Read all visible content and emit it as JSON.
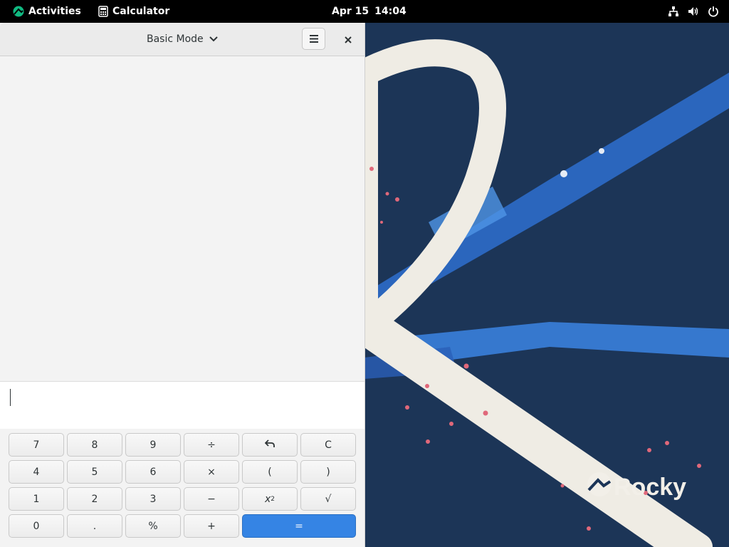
{
  "topbar": {
    "activities": "Activities",
    "app_name": "Calculator",
    "date": "Apr 15",
    "time": "14:04"
  },
  "window": {
    "mode_label": "Basic Mode",
    "display_expression": ""
  },
  "keypad": {
    "row1": [
      "7",
      "8",
      "9",
      "÷",
      "⟲",
      "C"
    ],
    "row2": [
      "4",
      "5",
      "6",
      "×",
      "(",
      ")"
    ],
    "row3": [
      "1",
      "2",
      "3",
      "−",
      "x",
      "√"
    ],
    "row3_superscript": "2",
    "row4": [
      "0",
      ".",
      "%",
      "+",
      "="
    ]
  },
  "wallpaper": {
    "brand": "Rocky"
  },
  "colors": {
    "equals_button": "#3584e4",
    "wallpaper_bg": "#1c3557",
    "topbar_bg": "#000000"
  }
}
